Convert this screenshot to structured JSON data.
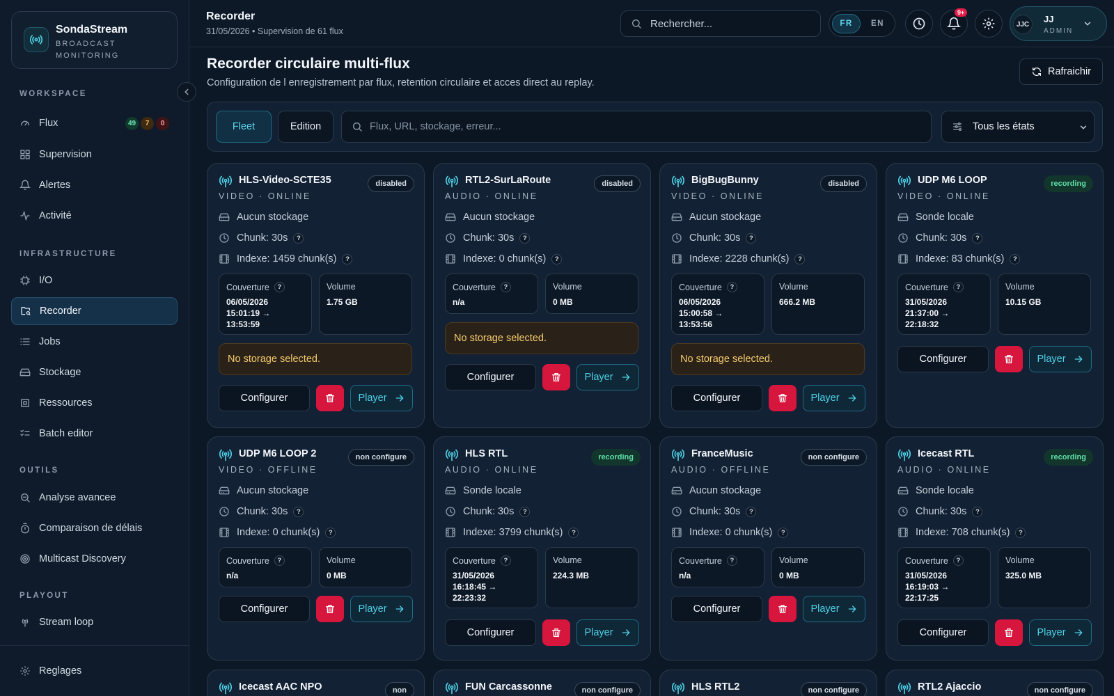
{
  "sidebar": {
    "brand_name": "SondaStream",
    "brand_sub": "BROADCAST MONITORING",
    "sections": {
      "workspace": "WORKSPACE",
      "infrastructure": "INFRASTRUCTURE",
      "outils": "OUTILS",
      "playout": "PLAYOUT"
    },
    "items": {
      "flux": "Flux",
      "supervision": "Supervision",
      "alertes": "Alertes",
      "activite": "Activité",
      "io": "I/O",
      "recorder": "Recorder",
      "jobs": "Jobs",
      "stockage": "Stockage",
      "ressources": "Ressources",
      "batch": "Batch editor",
      "analyse": "Analyse avancee",
      "comparaison": "Comparaison de délais",
      "multicast": "Multicast Discovery",
      "streamloop": "Stream loop",
      "reglages": "Reglages"
    },
    "flux_counts": {
      "ok": "49",
      "warn": "7",
      "err": "0"
    }
  },
  "header": {
    "title": "Recorder",
    "subtitle": "31/05/2026 • Supervision de 61 flux",
    "search_placeholder": "Rechercher...",
    "lang_fr": "FR",
    "lang_en": "EN",
    "notif_count": "9+",
    "user_initials": "JJC",
    "user_name": "JJ",
    "user_role": "ADMIN"
  },
  "main": {
    "title": "Recorder circulaire multi-flux",
    "subtitle": "Configuration de l enregistrement par flux, retention circulaire et acces direct au replay.",
    "refresh_label": "Rafraichir",
    "tab_fleet": "Fleet",
    "tab_edition": "Edition",
    "filter_placeholder": "Flux, URL, stockage, erreur...",
    "state_filter": "Tous les états"
  },
  "labels": {
    "coverage": "Couverture",
    "volume": "Volume",
    "configure": "Configurer",
    "player": "Player",
    "help": "?"
  },
  "cards": [
    {
      "name": "HLS-Video-SCTE35",
      "type": "VIDEO · ONLINE",
      "status": "disabled",
      "storage": "Aucun stockage",
      "chunk": "Chunk: 30s",
      "indexed": "Indexe: 1459 chunk(s)",
      "coverage": "06/05/2026\n15:01:19 →\n13:53:59",
      "volume": "1.75 GB",
      "warning": "No storage selected."
    },
    {
      "name": "RTL2-SurLaRoute",
      "type": "AUDIO · ONLINE",
      "status": "disabled",
      "storage": "Aucun stockage",
      "chunk": "Chunk: 30s",
      "indexed": "Indexe: 0 chunk(s)",
      "coverage": "n/a",
      "volume": "0 MB",
      "warning": "No storage selected."
    },
    {
      "name": "BigBugBunny",
      "type": "VIDEO · ONLINE",
      "status": "disabled",
      "storage": "Aucun stockage",
      "chunk": "Chunk: 30s",
      "indexed": "Indexe: 2228 chunk(s)",
      "coverage": "06/05/2026\n15:00:58 →\n13:53:56",
      "volume": "666.2 MB",
      "warning": "No storage selected."
    },
    {
      "name": "UDP M6 LOOP",
      "type": "VIDEO · ONLINE",
      "status": "recording",
      "storage": "Sonde locale",
      "chunk": "Chunk: 30s",
      "indexed": "Indexe: 83 chunk(s)",
      "coverage": "31/05/2026\n21:37:00 →\n22:18:32",
      "volume": "10.15 GB",
      "warning": ""
    },
    {
      "name": "UDP M6 LOOP 2",
      "type": "VIDEO · OFFLINE",
      "status": "non configure",
      "storage": "Aucun stockage",
      "chunk": "Chunk: 30s",
      "indexed": "Indexe: 0 chunk(s)",
      "coverage": "n/a",
      "volume": "0 MB",
      "warning": ""
    },
    {
      "name": "HLS RTL",
      "type": "AUDIO · ONLINE",
      "status": "recording",
      "storage": "Sonde locale",
      "chunk": "Chunk: 30s",
      "indexed": "Indexe: 3799 chunk(s)",
      "coverage": "31/05/2026\n16:18:45 →\n22:23:32",
      "volume": "224.3 MB",
      "warning": ""
    },
    {
      "name": "FranceMusic",
      "type": "AUDIO · OFFLINE",
      "status": "non configure",
      "storage": "Aucun stockage",
      "chunk": "Chunk: 30s",
      "indexed": "Indexe: 0 chunk(s)",
      "coverage": "n/a",
      "volume": "0 MB",
      "warning": ""
    },
    {
      "name": "Icecast RTL",
      "type": "AUDIO · ONLINE",
      "status": "recording",
      "storage": "Sonde locale",
      "chunk": "Chunk: 30s",
      "indexed": "Indexe: 708 chunk(s)",
      "coverage": "31/05/2026\n16:19:03 →\n22:17:25",
      "volume": "325.0 MB",
      "warning": ""
    },
    {
      "name": "Icecast AAC NPO",
      "status": "non"
    },
    {
      "name": "FUN Carcassonne",
      "status": "non configure"
    },
    {
      "name": "HLS RTL2",
      "status": "non configure"
    },
    {
      "name": "RTL2 Ajaccio",
      "status": "non configure"
    }
  ]
}
